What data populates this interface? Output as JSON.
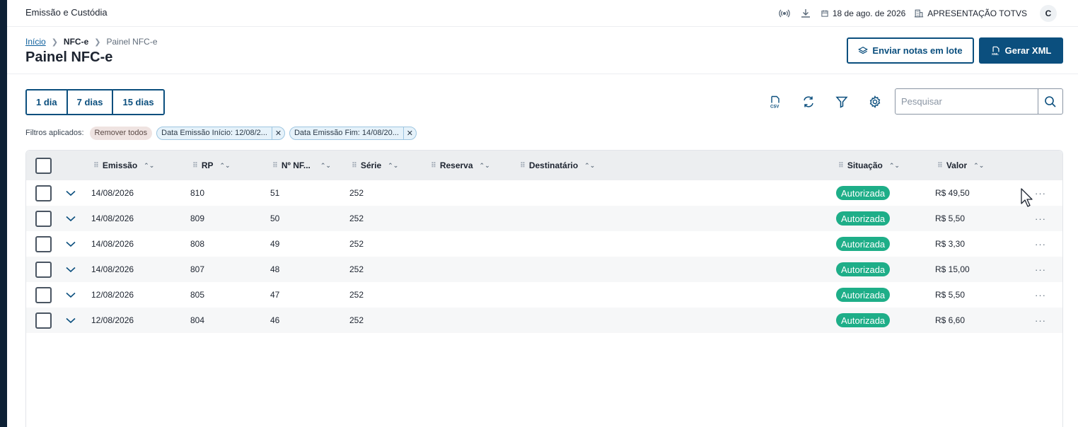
{
  "header": {
    "app_title": "Emissão e Custódia",
    "date": "18 de ago. de 2026",
    "company": "APRESENTAÇÃO TOTVS",
    "avatar_initial": "C"
  },
  "breadcrumb": {
    "home": "Início",
    "section": "NFC-e",
    "current": "Painel NFC-e"
  },
  "page": {
    "title": "Painel NFC-e",
    "send_batch_label": "Enviar notas em lote",
    "generate_xml_label": "Gerar XML"
  },
  "period_filter": {
    "options": [
      "1 dia",
      "7 dias",
      "15 dias"
    ]
  },
  "toolbar": {
    "search_placeholder": "Pesquisar"
  },
  "filters": {
    "label": "Filtros aplicados:",
    "remove_all_label": "Remover todos",
    "chips": [
      "Data Emissão Início: 12/08/2...",
      "Data Emissão Fim: 14/08/20..."
    ]
  },
  "table": {
    "columns": [
      "Emissão",
      "RP",
      "Nº NF...",
      "Série",
      "Reserva",
      "Destinatário",
      "Situação",
      "Valor"
    ],
    "rows": [
      {
        "emissao": "14/08/2026",
        "rp": "810",
        "nf": "51",
        "serie": "252",
        "reserva": "",
        "destinatario": "",
        "situacao": "Autorizada",
        "valor": "R$ 49,50"
      },
      {
        "emissao": "14/08/2026",
        "rp": "809",
        "nf": "50",
        "serie": "252",
        "reserva": "",
        "destinatario": "",
        "situacao": "Autorizada",
        "valor": "R$ 5,50"
      },
      {
        "emissao": "14/08/2026",
        "rp": "808",
        "nf": "49",
        "serie": "252",
        "reserva": "",
        "destinatario": "",
        "situacao": "Autorizada",
        "valor": "R$ 3,30"
      },
      {
        "emissao": "14/08/2026",
        "rp": "807",
        "nf": "48",
        "serie": "252",
        "reserva": "",
        "destinatario": "",
        "situacao": "Autorizada",
        "valor": "R$ 15,00"
      },
      {
        "emissao": "12/08/2026",
        "rp": "805",
        "nf": "47",
        "serie": "252",
        "reserva": "",
        "destinatario": "",
        "situacao": "Autorizada",
        "valor": "R$ 5,50"
      },
      {
        "emissao": "12/08/2026",
        "rp": "804",
        "nf": "46",
        "serie": "252",
        "reserva": "",
        "destinatario": "",
        "situacao": "Autorizada",
        "valor": "R$ 6,60"
      }
    ]
  },
  "colors": {
    "primary": "#0b4f7e",
    "status_authorized": "#1eae88",
    "header_bg": "#eceef0"
  },
  "icons": [
    "radio-signal-icon",
    "download-icon",
    "calendar-icon",
    "building-icon",
    "layers-icon",
    "xml-file-icon",
    "csv-icon",
    "refresh-icon",
    "filter-icon",
    "gear-icon",
    "search-icon",
    "chevron-down-icon",
    "more-icon",
    "mouse-cursor-icon"
  ]
}
